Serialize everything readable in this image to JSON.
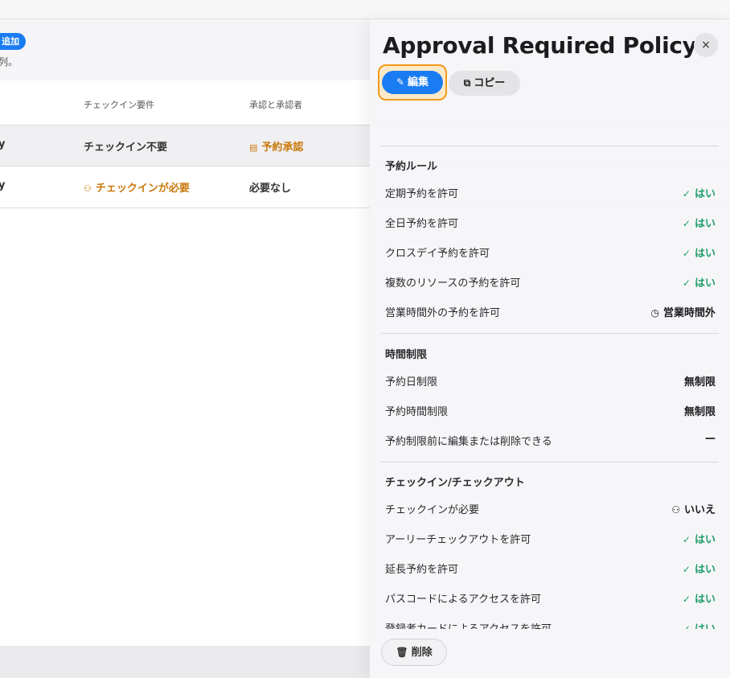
{
  "background": {
    "add_badge": "追加",
    "subtext": "列。",
    "columns": [
      "チェックイン要件",
      "承認と承認者"
    ],
    "rows": [
      {
        "name_cut": "y",
        "checkin": "チェックイン不要",
        "approval": "予約承認",
        "approval_icon": "calendar-check-icon"
      },
      {
        "name_cut": "y",
        "checkin": "チェックインが必要",
        "checkin_icon": "person-check-icon",
        "approval": "必要なし"
      }
    ]
  },
  "drawer": {
    "title": "Approval Required Policy",
    "close_icon": "×",
    "edit_label": "編集",
    "edit_icon": "✎",
    "copy_label": "コピー",
    "copy_icon": "⧉",
    "delete_label": "削除",
    "delete_icon": "🗑",
    "sections": [
      {
        "title": "予約ルール",
        "items": [
          {
            "label": "定期予約を許可",
            "value": "はい",
            "icon": "✓",
            "status": "yes"
          },
          {
            "label": "全日予約を許可",
            "value": "はい",
            "icon": "✓",
            "status": "yes"
          },
          {
            "label": "クロスデイ予約を許可",
            "value": "はい",
            "icon": "✓",
            "status": "yes"
          },
          {
            "label": "複数のリソースの予約を許可",
            "value": "はい",
            "icon": "✓",
            "status": "yes"
          },
          {
            "label": "営業時間外の予約を許可",
            "value": "営業時間外",
            "icon": "◷",
            "status": "neutral"
          }
        ]
      },
      {
        "title": "時間制限",
        "items": [
          {
            "label": "予約日制限",
            "value": "無制限"
          },
          {
            "label": "予約時間制限",
            "value": "無制限"
          },
          {
            "label": "予約制限前に編集または削除できる",
            "value": "—"
          }
        ]
      },
      {
        "title": "チェックイン/チェックアウト",
        "items": [
          {
            "label": "チェックインが必要",
            "value": "いいえ",
            "icon": "⚇",
            "status": "neutral"
          },
          {
            "label": "アーリーチェックアウトを許可",
            "value": "はい",
            "icon": "✓",
            "status": "yes"
          },
          {
            "label": "延長予約を許可",
            "value": "はい",
            "icon": "✓",
            "status": "yes"
          },
          {
            "label": "パスコードによるアクセスを許可",
            "value": "はい",
            "icon": "✓",
            "status": "yes"
          },
          {
            "label": "登録者カードによるアクセスを許可",
            "value": "はい",
            "icon": "✓",
            "status": "yes"
          }
        ]
      }
    ]
  },
  "colors": {
    "accent": "#1a7cf2",
    "yes": "#1f9d6b",
    "warning": "#c9790c",
    "focus_ring": "#f19a1a"
  }
}
